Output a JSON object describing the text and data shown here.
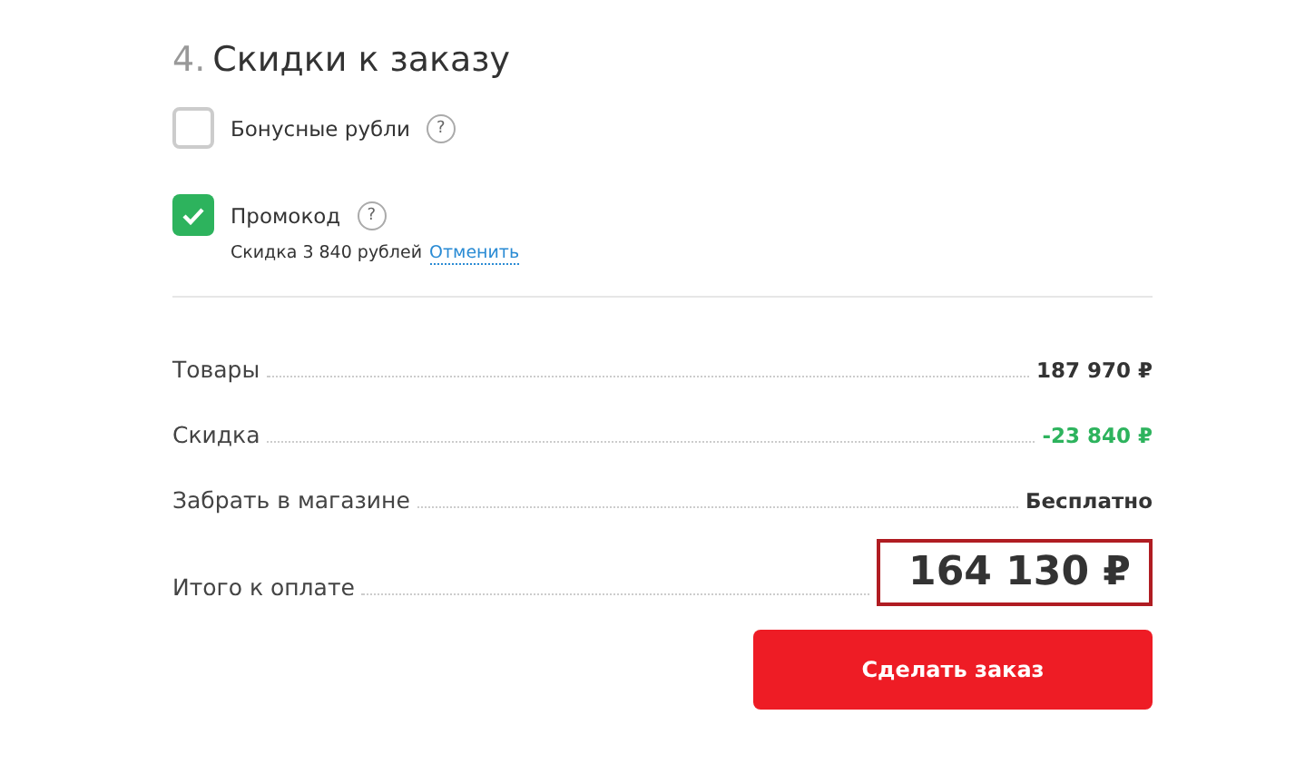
{
  "section": {
    "number": "4.",
    "title": "Скидки к заказу"
  },
  "options": [
    {
      "label": "Бонусные рубли",
      "help": "?",
      "checked": false
    },
    {
      "label": "Промокод",
      "help": "?",
      "checked": true,
      "note": "Скидка 3 840 рублей",
      "link": "Отменить"
    }
  ],
  "summary": [
    {
      "kind": "normal",
      "label": "Товары",
      "value": "187 970 ₽",
      "highlighted": false
    },
    {
      "kind": "discount",
      "label": "Скидка",
      "value": "-23 840 ₽",
      "highlighted": false
    },
    {
      "kind": "normal",
      "label": "Забрать в магазине",
      "value": "Бесплатно",
      "highlighted": false
    },
    {
      "kind": "total",
      "label": "Итого к оплате",
      "value": "164 130 ₽",
      "highlighted": true
    }
  ],
  "submit": "Сделать заказ"
}
